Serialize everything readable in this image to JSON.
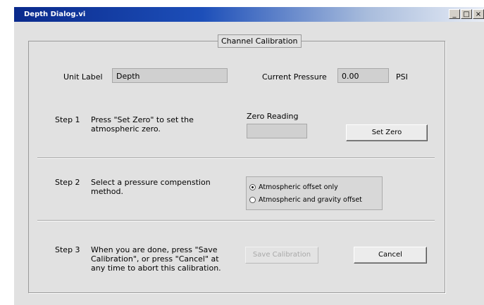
{
  "window": {
    "title": "Depth Dialog.vi",
    "controls": [
      "minimize-icon",
      "maximize-icon",
      "close-icon"
    ],
    "minimize_glyph": "_",
    "maximize_glyph": "□",
    "close_glyph": "×"
  },
  "panel": {
    "caption": "Channel Calibration"
  },
  "unit": {
    "label": "Unit Label",
    "value": "Depth"
  },
  "pressure": {
    "label": "Current Pressure",
    "value": "0.00",
    "units": "PSI"
  },
  "step1": {
    "number": "Step 1",
    "line1": "Press \"Set Zero\" to set the",
    "line2": "atmospheric zero.",
    "zero_label": "Zero Reading",
    "zero_value": "",
    "button": "Set Zero"
  },
  "step2": {
    "number": "Step 2",
    "line1": "Select a pressure compenstion",
    "line2": "method.",
    "options": [
      "Atmospheric offset only",
      "Atmospheric and gravity offset"
    ],
    "selected_index": 0
  },
  "step3": {
    "number": "Step 3",
    "line1": "When you are done, press \"Save",
    "line2": "Calibration\", or press \"Cancel\" at",
    "line3": "any time to abort this calibration.",
    "save_button": "Save Calibration",
    "save_enabled": false,
    "cancel_button": "Cancel"
  }
}
